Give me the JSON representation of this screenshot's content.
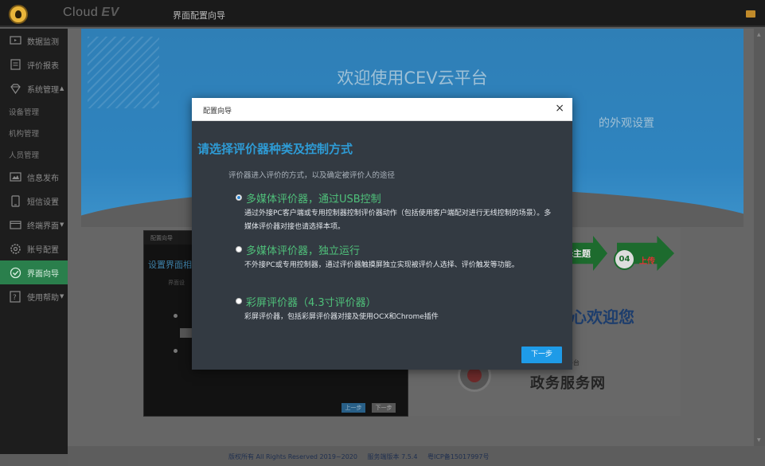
{
  "topbar": {
    "brand": "Cloud",
    "brand_bold": "EV",
    "page_title": "界面配置向导"
  },
  "sidebar": {
    "items": [
      {
        "label": "数据监测",
        "icon": "monitor-icon"
      },
      {
        "label": "评价报表",
        "icon": "report-icon"
      },
      {
        "label": "系统管理",
        "icon": "diamond-icon"
      },
      {
        "label": "设备管理"
      },
      {
        "label": "机构管理"
      },
      {
        "label": "人员管理"
      },
      {
        "label": "信息发布",
        "icon": "image-icon"
      },
      {
        "label": "短信设置",
        "icon": "phone-icon"
      },
      {
        "label": "终端界面",
        "icon": "display-icon"
      },
      {
        "label": "账号配置",
        "icon": "gear-icon"
      },
      {
        "label": "界面向导",
        "icon": "check-circle-icon"
      },
      {
        "label": "使用帮助",
        "icon": "help-icon"
      }
    ]
  },
  "banner": {
    "title": "欢迎使用CEV云平台",
    "subtitle": "的外观设置"
  },
  "preview_left": {
    "header": "配置向导",
    "title": "设置界面相",
    "subtitle": "界面设",
    "prev_btn": "上一步",
    "next_btn": "下一步"
  },
  "preview_right": {
    "step_num": "04",
    "step_label": "上传",
    "step_label_left": "择主题",
    "welcome": "心欢迎您",
    "gov_small": "府服务平台",
    "gov_text": "政务服务网"
  },
  "modal": {
    "header_title": "配置向导",
    "close": "×",
    "title": "请选择评价器种类及控制方式",
    "description": "评价器进入评价的方式，以及确定被评价人的途径",
    "options": [
      {
        "title": "多媒体评价器，通过USB控制",
        "text": "通过外接PC客户端或专用控制器控制评价器动作（包括使用客户端配对进行无线控制的场景）。多媒体评价器对接也请选择本项。",
        "selected": true
      },
      {
        "title": "多媒体评价器，独立运行",
        "text": "不外接PC或专用控制器，通过评价器触摸屏独立实现被评价人选择、评价触发等功能。",
        "selected": false
      },
      {
        "title": "彩屏评价器（4.3寸评价器）",
        "text": "彩屏评价器，包括彩屏评价器对接及使用OCX和Chrome插件",
        "selected": false
      }
    ],
    "next_button": "下一步"
  },
  "footer": {
    "copyright": "版权所有 All Rights Reserved 2019~2020",
    "version": "服务端版本 7.5.4",
    "icp": "粤ICP备15017997号"
  },
  "colors": {
    "accent_blue": "#2e9bd5",
    "option_green": "#4fc07a",
    "sidebar_active": "#2a7f4c",
    "button_blue": "#1e9be8"
  }
}
